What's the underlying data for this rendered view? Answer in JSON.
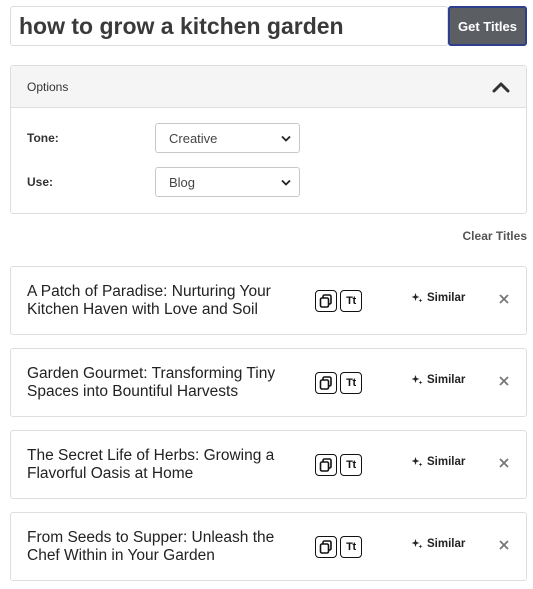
{
  "search": {
    "value": "how to grow a kitchen garden",
    "button_label": "Get Titles"
  },
  "options": {
    "title": "Options",
    "tone": {
      "label": "Tone:",
      "value": "Creative"
    },
    "use": {
      "label": "Use:",
      "value": "Blog"
    }
  },
  "clear_label": "Clear Titles",
  "titles": [
    {
      "text": "A Patch of Paradise: Nurturing Your Kitchen Haven with Love and Soil",
      "similar_label": "Similar",
      "copy_icon": "copy-icon",
      "case_icon": "Tt"
    },
    {
      "text": "Garden Gourmet: Transforming Tiny Spaces into Bountiful Harvests",
      "similar_label": "Similar",
      "copy_icon": "copy-icon",
      "case_icon": "Tt"
    },
    {
      "text": "The Secret Life of Herbs: Growing a Flavorful Oasis at Home",
      "similar_label": "Similar",
      "copy_icon": "copy-icon",
      "case_icon": "Tt"
    },
    {
      "text": "From Seeds to Supper: Unleash the Chef Within in Your Garden",
      "similar_label": "Similar",
      "copy_icon": "copy-icon",
      "case_icon": "Tt"
    }
  ],
  "colors": {
    "button_bg": "#5b5f63",
    "button_border": "#2d3e8c",
    "panel_header_bg": "#f5f5f5"
  }
}
